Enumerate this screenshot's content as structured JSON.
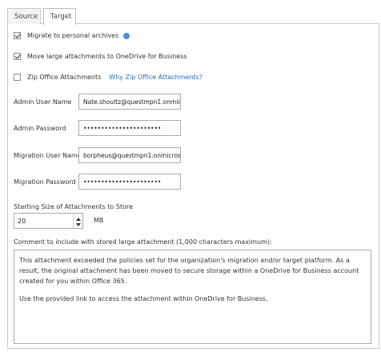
{
  "tabs": {
    "source": "Source",
    "target": "Target"
  },
  "options": {
    "migrate_personal_archives": {
      "label": "Migrate to personal archives",
      "checked": true,
      "icon": "info-icon"
    },
    "move_large_attachments": {
      "label": "Move large attachments to OneDrive for Business",
      "checked": true
    },
    "zip_office_attachments": {
      "label": "Zip Office Attachments",
      "checked": false,
      "link": "Why Zip Office Attachments?"
    }
  },
  "fields": {
    "admin_user_name": {
      "label": "Admin User Name",
      "value": "Nate.shoultz@questmpn1.onmicr"
    },
    "admin_password": {
      "label": "Admin Password",
      "value": "••••••••••••••••••••••"
    },
    "migration_user_name": {
      "label": "Migration User Name",
      "value": "borpheus@questmpn1.onmicroso"
    },
    "migration_password": {
      "label": "Migration Password",
      "value": "••••••••••••••••••••••"
    }
  },
  "attachment_size": {
    "label": "Starting Size of Attachments to Store",
    "value": "20",
    "unit": "MB"
  },
  "comment": {
    "label": "Comment to include with stored large attachment (1,000 characters maximum):",
    "paragraph1": "This attachment exceeded the policies set for the organization's migration and/or target platform. As a result, the original attachment has been moved to secure storage within a OneDrive for Business account created for you within Office 365.",
    "paragraph2": "Use the provided link to access the attachment within OneDrive for Business."
  },
  "colors": {
    "link": "#2a6ebb",
    "info_icon": "#4a90d9",
    "border": "#c9c9c9"
  }
}
